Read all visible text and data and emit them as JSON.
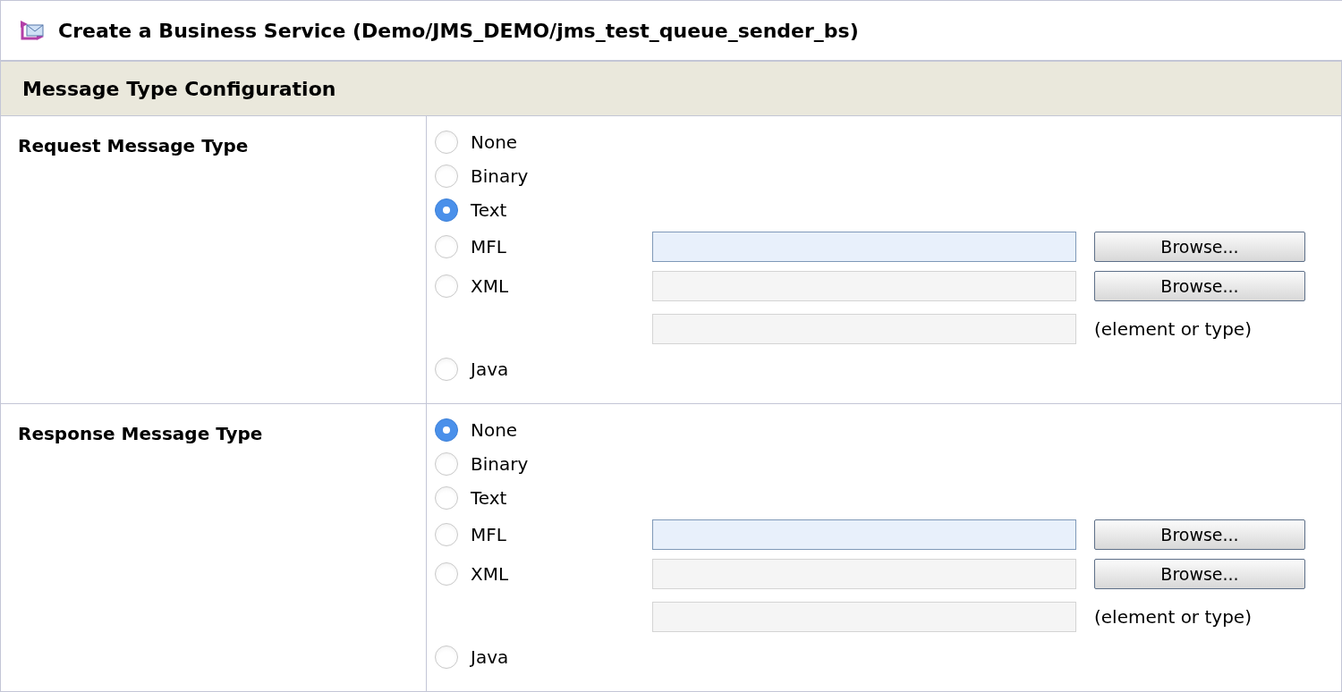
{
  "window": {
    "title": "Create a Business Service (Demo/JMS_DEMO/jms_test_queue_sender_bs)"
  },
  "section_header": "Message Type Configuration",
  "groups": [
    {
      "label": "Request Message Type",
      "options": [
        {
          "kind": "plain",
          "label": "None",
          "selected": false
        },
        {
          "kind": "plain",
          "label": "Binary",
          "selected": false
        },
        {
          "kind": "plain",
          "label": "Text",
          "selected": true
        },
        {
          "kind": "file",
          "label": "MFL",
          "selected": false,
          "field": {
            "enabled": true
          },
          "button": "Browse..."
        },
        {
          "kind": "xml",
          "label": "XML",
          "selected": false,
          "field": {
            "enabled": false
          },
          "button": "Browse...",
          "element_field": {
            "enabled": false
          },
          "element_note": "(element or type)"
        },
        {
          "kind": "plain",
          "label": "Java",
          "selected": false
        }
      ]
    },
    {
      "label": "Response Message Type",
      "options": [
        {
          "kind": "plain",
          "label": "None",
          "selected": true
        },
        {
          "kind": "plain",
          "label": "Binary",
          "selected": false
        },
        {
          "kind": "plain",
          "label": "Text",
          "selected": false
        },
        {
          "kind": "file",
          "label": "MFL",
          "selected": false,
          "field": {
            "enabled": true
          },
          "button": "Browse..."
        },
        {
          "kind": "xml",
          "label": "XML",
          "selected": false,
          "field": {
            "enabled": false
          },
          "button": "Browse...",
          "element_field": {
            "enabled": false
          },
          "element_note": "(element or type)"
        },
        {
          "kind": "plain",
          "label": "Java",
          "selected": false
        }
      ]
    }
  ]
}
